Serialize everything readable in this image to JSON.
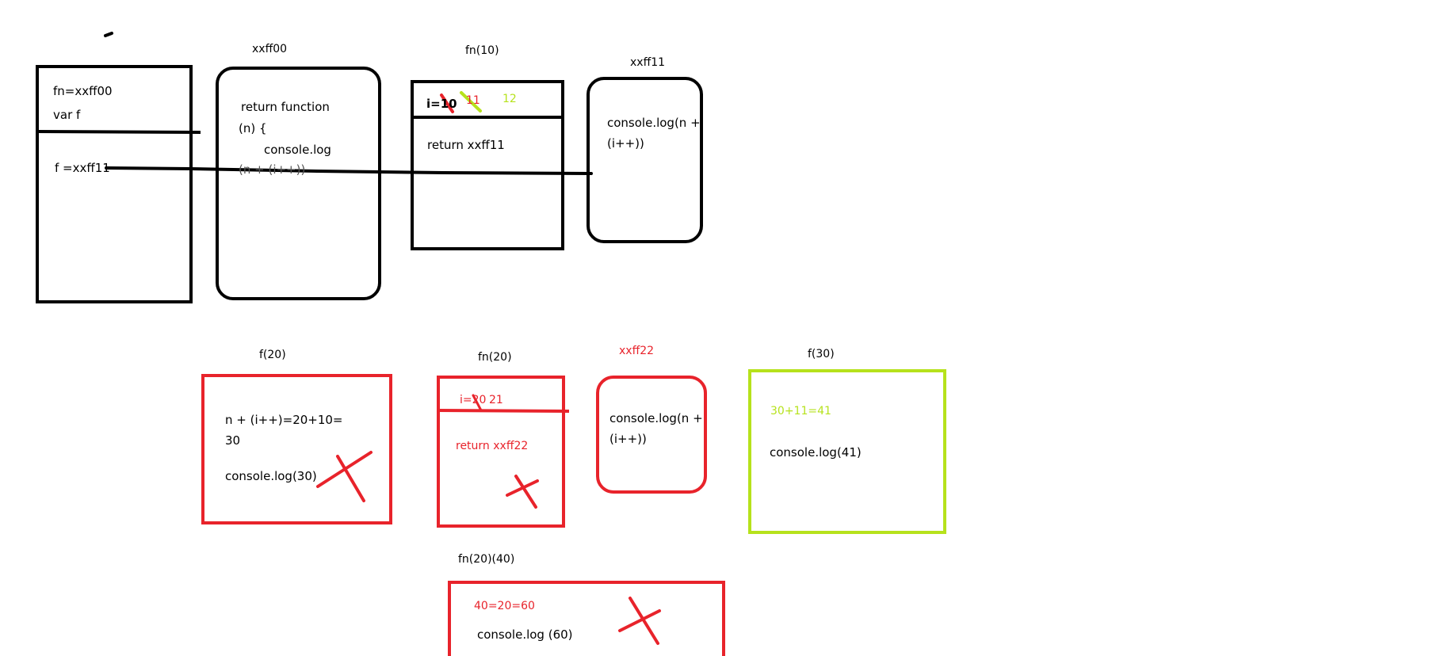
{
  "colors": {
    "black": "#000000",
    "red": "#e8232b",
    "green": "#b6e21c"
  },
  "global_scope": {
    "line1": "fn=xxff00",
    "line2": "var f",
    "line3": "f =xxff11"
  },
  "heap1": {
    "label": "xxff00",
    "line1": "return function",
    "line2": "(n) {",
    "line3": "console.log",
    "line4": "(n + (i++))"
  },
  "call1": {
    "label": "fn(10)",
    "var": "i=10",
    "v2": "11",
    "v3": "12",
    "ret": "return xxff11"
  },
  "heap2": {
    "label": "xxff11",
    "line1": "console.log(n +",
    "line2": "(i++))"
  },
  "f20": {
    "label": "f(20)",
    "line1": "n + (i++)=20+10=",
    "line2": "30",
    "line3": "console.log(30)"
  },
  "fn20": {
    "label": "fn(20)",
    "var": "i=20",
    "v2": "21",
    "ret": "return xxff22"
  },
  "heap3": {
    "label": "xxff22",
    "line1": "console.log(n +",
    "line2": "(i++))"
  },
  "f30": {
    "label": "f(30)",
    "calc": "30+11=41",
    "line1": "console.log(41)"
  },
  "fn20_40": {
    "label": "fn(20)(40)",
    "calc": "40=20=60",
    "line1": "console.log (60)"
  }
}
